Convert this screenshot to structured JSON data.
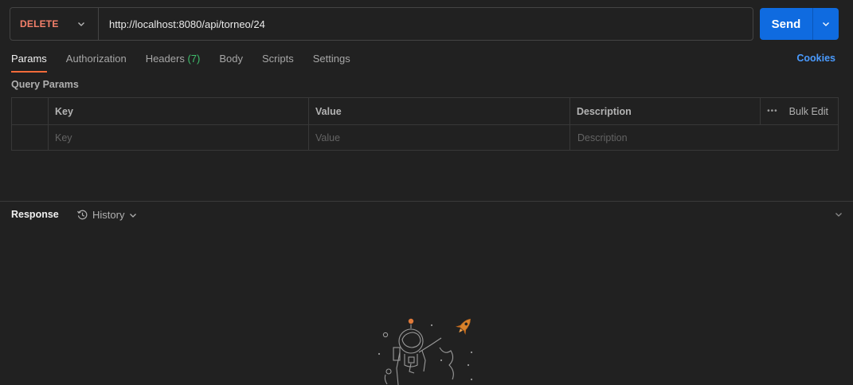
{
  "request": {
    "method": "DELETE",
    "url": "http://localhost:8080/api/torneo/24",
    "send_label": "Send"
  },
  "tabs": [
    {
      "label": "Params",
      "active": true
    },
    {
      "label": "Authorization"
    },
    {
      "label": "Headers",
      "badge": "(7)"
    },
    {
      "label": "Body"
    },
    {
      "label": "Scripts"
    },
    {
      "label": "Settings"
    }
  ],
  "cookies_label": "Cookies",
  "query_params": {
    "title": "Query Params",
    "columns": {
      "key": "Key",
      "value": "Value",
      "description": "Description"
    },
    "bulk_edit": "Bulk Edit",
    "placeholders": {
      "key": "Key",
      "value": "Value",
      "description": "Description"
    }
  },
  "response": {
    "title": "Response",
    "history_label": "History"
  },
  "colors": {
    "method": "#f4806a",
    "send": "#0f6be0",
    "active_tab_underline": "#f26b3a",
    "badge": "#3fbf6c",
    "link": "#4a9bff"
  }
}
